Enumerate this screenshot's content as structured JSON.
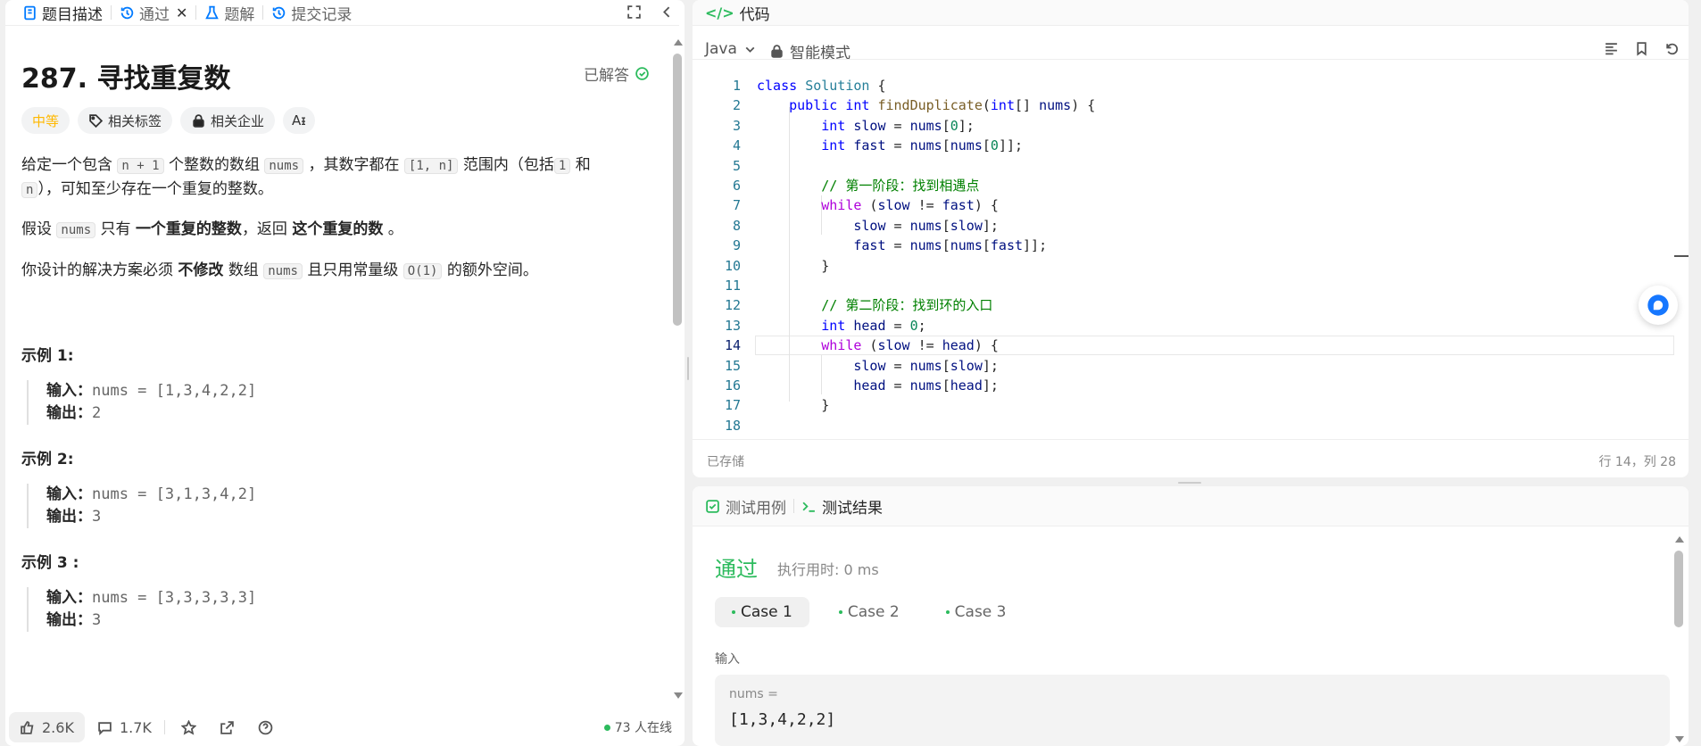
{
  "left_tabs": [
    {
      "label": "题目描述"
    },
    {
      "label": "通过"
    },
    {
      "label": "题解"
    },
    {
      "label": "提交记录"
    }
  ],
  "problem": {
    "title": "287. 寻找重复数",
    "status": "已解答",
    "difficulty": "中等",
    "tags_label": "相关标签",
    "companies_label": "相关企业",
    "font_label": "Aᵻ",
    "p1": {
      "a": "给定一个包含",
      "c1": "n + 1",
      "b": "个整数的数组",
      "c2": "nums",
      "d": "，其数字都在",
      "c3": "[1, n]",
      "e": "范围内（包括",
      "c4": "1",
      "f": "和",
      "c5": "n",
      "g": "），可知至少存在一个重复的整数。"
    },
    "p2": {
      "a": "假设",
      "c1": "nums",
      "b": "只有",
      "s1": "一个重复的整数",
      "c": "，返回",
      "s2": "这个重复的数",
      "d": "。"
    },
    "p3": {
      "a": "你设计的解决方案必须",
      "s1": "不修改",
      "b": "数组",
      "c1": "nums",
      "c": "且只用常量级",
      "c2": "O(1)",
      "d": "的额外空间。"
    },
    "examples": [
      {
        "heading": "示例 1:",
        "input_label": "输入：",
        "input": "nums = [1,3,4,2,2]",
        "output_label": "输出：",
        "output": "2"
      },
      {
        "heading": "示例 2:",
        "input_label": "输入：",
        "input": "nums = [3,1,3,4,2]",
        "output_label": "输出：",
        "output": "3"
      },
      {
        "heading": "示例 3 :",
        "input_label": "输入：",
        "input": "nums = [3,3,3,3,3]",
        "output_label": "输出：",
        "output": "3"
      }
    ]
  },
  "footer": {
    "likes": "2.6K",
    "comments": "1.7K",
    "online": "73 人在线"
  },
  "code_panel": {
    "title": "代码",
    "language": "Java",
    "mode": "智能模式",
    "saved": "已存储",
    "cursor": "行 14，列 28",
    "current_line": 14
  },
  "result_panel": {
    "tab_testcase": "测试用例",
    "tab_result": "测试结果",
    "status": "通过",
    "runtime": "执行用时: 0 ms",
    "cases": [
      "Case 1",
      "Case 2",
      "Case 3"
    ],
    "input_label": "输入",
    "var_label": "nums =",
    "var_value": "[1,3,4,2,2]"
  },
  "colors": {
    "accent_green": "#2cbb5d",
    "medium": "#ffb800",
    "link_blue": "#007aff"
  }
}
